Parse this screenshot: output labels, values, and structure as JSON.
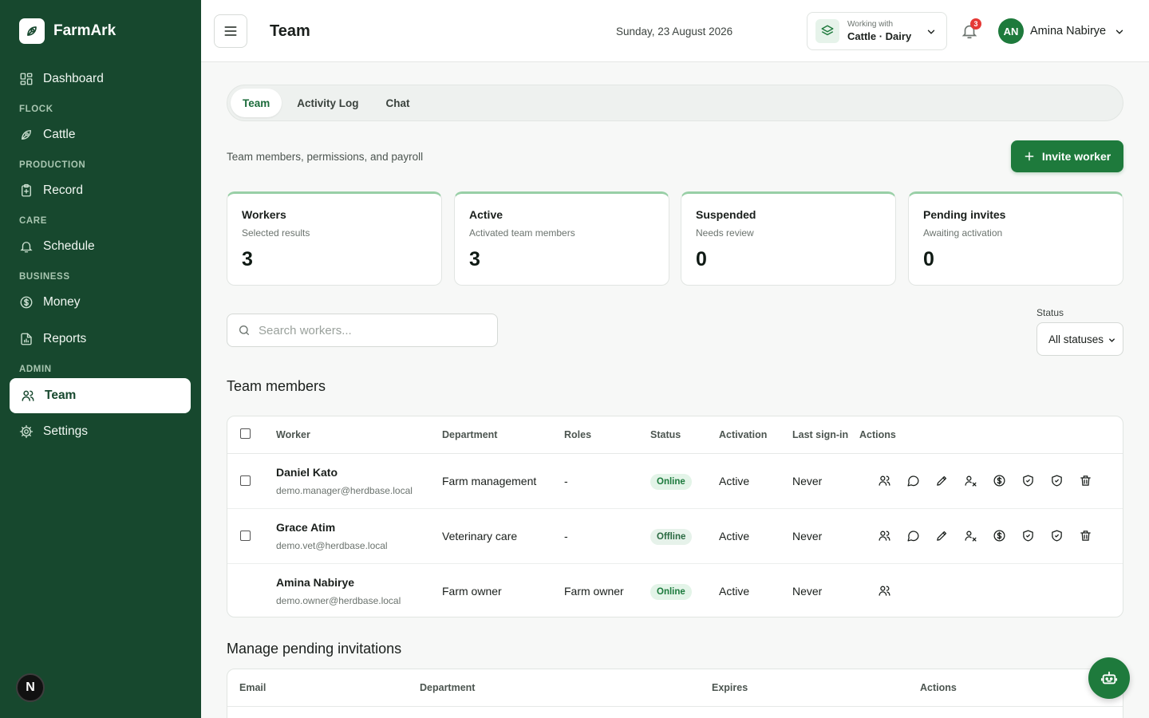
{
  "brand": {
    "name": "FarmArk"
  },
  "sidebar": {
    "items": [
      {
        "label": "Dashboard"
      },
      {
        "section": "FLOCK",
        "label": "Cattle"
      },
      {
        "section": "PRODUCTION",
        "label": "Record"
      },
      {
        "section": "CARE",
        "label": "Schedule"
      },
      {
        "section": "BUSINESS",
        "label": "Money"
      },
      {
        "label": "Reports"
      },
      {
        "section": "ADMIN",
        "label": "Team",
        "active": true
      },
      {
        "label": "Settings"
      }
    ]
  },
  "dev_badge": "N",
  "header": {
    "title": "Team",
    "date": "Sunday, 23 August 2026",
    "context": {
      "caption": "Working with",
      "value": "Cattle · Dairy"
    },
    "notifications_count": "3",
    "user": {
      "initials": "AN",
      "name": "Amina Nabirye"
    }
  },
  "tabs": [
    {
      "label": "Team",
      "active": true
    },
    {
      "label": "Activity Log"
    },
    {
      "label": "Chat"
    }
  ],
  "subtitle": "Team members, permissions, and payroll",
  "invite_button": "Invite worker",
  "stats": [
    {
      "title": "Workers",
      "sub": "Selected results",
      "value": "3"
    },
    {
      "title": "Active",
      "sub": "Activated team members",
      "value": "3"
    },
    {
      "title": "Suspended",
      "sub": "Needs review",
      "value": "0"
    },
    {
      "title": "Pending invites",
      "sub": "Awaiting activation",
      "value": "0"
    }
  ],
  "search": {
    "placeholder": "Search workers..."
  },
  "status_filter": {
    "label": "Status",
    "value": "All statuses"
  },
  "team_section_title": "Team members",
  "team_table": {
    "headers": [
      "Worker",
      "Department",
      "Roles",
      "Status",
      "Activation",
      "Last sign-in",
      "Actions"
    ],
    "rows": [
      {
        "name": "Daniel Kato",
        "email": "demo.manager@herdbase.local",
        "department": "Farm management",
        "roles": "-",
        "status": "Online",
        "activation": "Active",
        "last_signin": "Never"
      },
      {
        "name": "Grace Atim",
        "email": "demo.vet@herdbase.local",
        "department": "Veterinary care",
        "roles": "-",
        "status": "Offline",
        "activation": "Active",
        "last_signin": "Never"
      },
      {
        "name": "Amina Nabirye",
        "email": "demo.owner@herdbase.local",
        "department": "Farm owner",
        "roles": "Farm owner",
        "status": "Online",
        "activation": "Active",
        "last_signin": "Never"
      }
    ]
  },
  "invites_section_title": "Manage pending invitations",
  "invites_table": {
    "headers": [
      "Email",
      "Department",
      "Expires",
      "Actions"
    ]
  },
  "colors": {
    "sidebar": "#17482e",
    "accent": "#1e7a3c",
    "badge": "#e53935"
  }
}
